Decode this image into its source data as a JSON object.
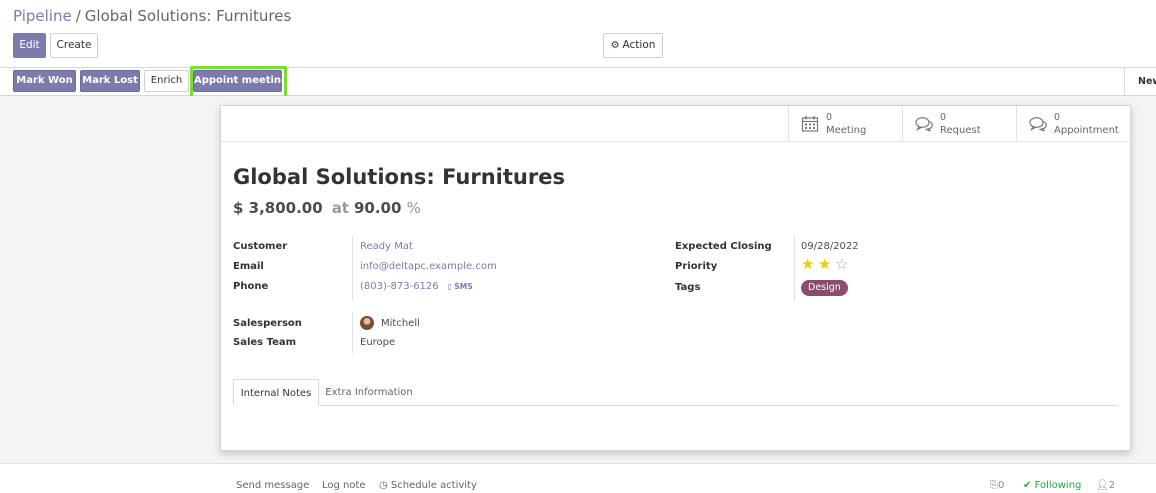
{
  "breadcrumb": {
    "parent": "Pipeline",
    "separator": "/",
    "current": "Global Solutions: Furnitures"
  },
  "control_panel": {
    "edit": "Edit",
    "create": "Create",
    "action": "Action",
    "action_icon": "gear-icon"
  },
  "statusbar": {
    "mark_won": "Mark Won",
    "mark_lost": "Mark Lost",
    "enrich": "Enrich",
    "appoint_meeting": "Appoint meeting",
    "stage": "New"
  },
  "smart_buttons": [
    {
      "count": "0",
      "label": "Meeting",
      "icon": "calendar-icon"
    },
    {
      "count": "0",
      "label": "Request",
      "icon": "chat-bubbles-icon"
    },
    {
      "count": "0",
      "label": "Appointment",
      "icon": "chat-bubbles-icon"
    }
  ],
  "lead": {
    "title": "Global Solutions: Furnitures",
    "revenue": "$ 3,800.00",
    "at": "at",
    "probability": "90.00",
    "percent_sign": "%"
  },
  "fields_left": {
    "customer_label": "Customer",
    "customer": "Ready Mat",
    "email_label": "Email",
    "email": "info@deltapc.example.com",
    "phone_label": "Phone",
    "phone": "(803)-873-6126",
    "sms": "SMS",
    "salesperson_label": "Salesperson",
    "salesperson": "Mitchell",
    "team_label": "Sales Team",
    "team": "Europe"
  },
  "fields_right": {
    "closing_label": "Expected Closing",
    "closing": "09/28/2022",
    "priority_label": "Priority",
    "priority_stars": 2,
    "priority_max": 3,
    "tags_label": "Tags",
    "tag": "Design",
    "tag_color": "#8b4c6e"
  },
  "tabs": {
    "internal_notes": "Internal Notes",
    "extra_info": "Extra Information"
  },
  "chatter": {
    "send_message": "Send message",
    "log_note": "Log note",
    "schedule_activity": "Schedule activity",
    "attachments": "0",
    "following": "Following",
    "followers": "2"
  },
  "colors": {
    "brand": "#7c7bad",
    "highlight": "#7cdc30",
    "star": "#f3cc00",
    "follow": "#28a745"
  }
}
